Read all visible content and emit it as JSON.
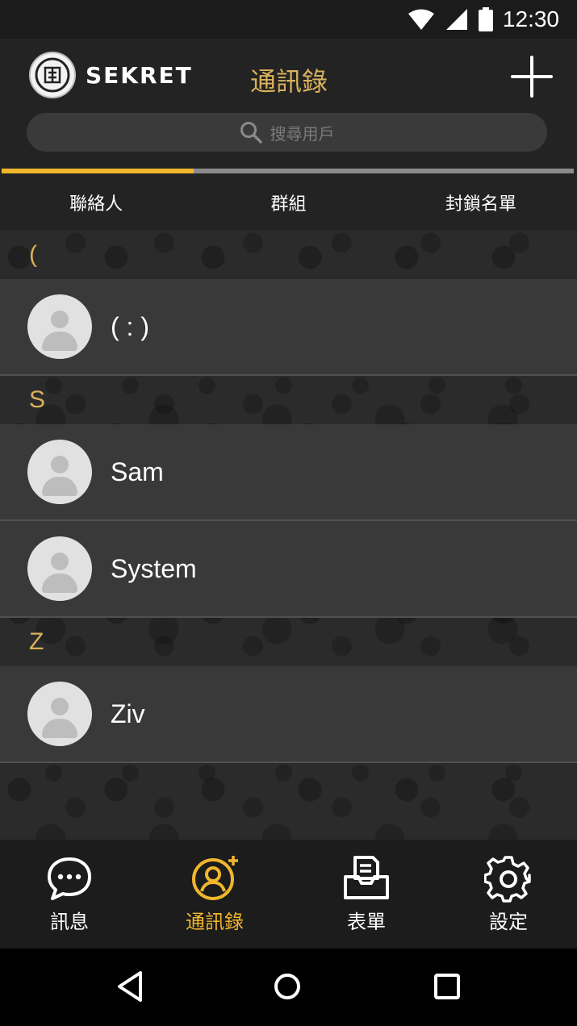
{
  "status": {
    "time": "12:30"
  },
  "header": {
    "logo_text": "SEKRET",
    "title": "通訊錄",
    "search_placeholder": "搜尋用戶"
  },
  "tabs": [
    {
      "label": "聯絡人",
      "active": true
    },
    {
      "label": "群組",
      "active": false
    },
    {
      "label": "封鎖名單",
      "active": false
    }
  ],
  "sections": [
    {
      "letter": "(",
      "contacts": [
        "( : )"
      ]
    },
    {
      "letter": "S",
      "contacts": [
        "Sam",
        "System"
      ]
    },
    {
      "letter": "Z",
      "contacts": [
        "Ziv"
      ]
    }
  ],
  "bottom_nav": [
    {
      "label": "訊息",
      "icon": "chat-bubble-icon",
      "active": false
    },
    {
      "label": "通訊錄",
      "icon": "contacts-add-icon",
      "active": true
    },
    {
      "label": "表單",
      "icon": "inbox-form-icon",
      "active": false
    },
    {
      "label": "設定",
      "icon": "gear-icon",
      "active": false
    }
  ],
  "colors": {
    "accent": "#f0b62d",
    "title_gold": "#d9b15c",
    "background": "#232323"
  }
}
